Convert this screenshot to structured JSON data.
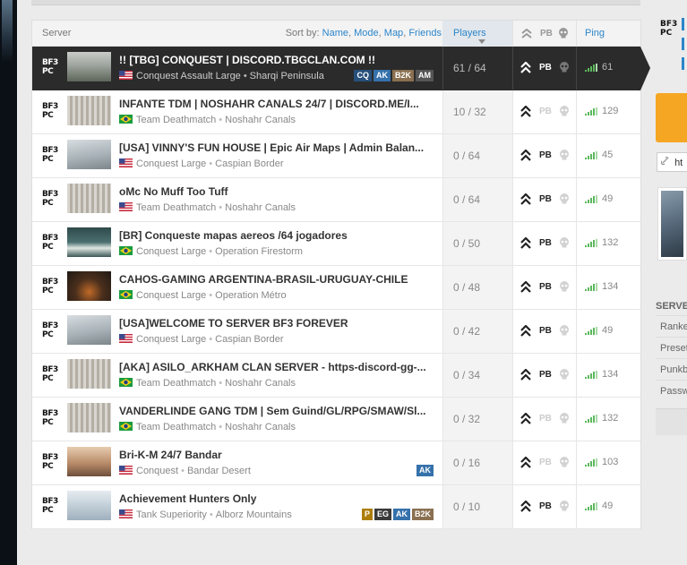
{
  "header": {
    "server_label": "Server",
    "sort_by_label": "Sort by:",
    "sort_options": [
      "Name",
      "Mode",
      "Map",
      "Friends"
    ],
    "players_label": "Players",
    "pb_label": "PB",
    "ping_label": "Ping"
  },
  "servers": [
    {
      "platform": "PC",
      "name": "!! [TBG] CONQUEST | DISCORD.TBGCLAN.COM !!",
      "mode": "Conquest Assault Large",
      "map": "Sharqi Peninsula",
      "flag": "us",
      "badges": [
        "CQ",
        "AK",
        "B2K",
        "AM"
      ],
      "players": "61 / 64",
      "pb": true,
      "ping": "61",
      "selected": true,
      "thumb": "a"
    },
    {
      "platform": "PC",
      "name": "INFANTE TDM | NOSHAHR CANALS 24/7 | DISCORD.ME/I...",
      "mode": "Team Deathmatch",
      "map": "Noshahr Canals",
      "flag": "br",
      "badges": [],
      "players": "10 / 32",
      "pb": false,
      "ping": "129",
      "selected": false,
      "thumb": "b"
    },
    {
      "platform": "PC",
      "name": "[USA] VINNY'S FUN HOUSE | Epic Air Maps | Admin Balan...",
      "mode": "Conquest Large",
      "map": "Caspian Border",
      "flag": "us",
      "badges": [],
      "players": "0 / 64",
      "pb": true,
      "ping": "45",
      "selected": false,
      "thumb": "c"
    },
    {
      "platform": "PC",
      "name": "oMc No Muff Too Tuff",
      "mode": "Team Deathmatch",
      "map": "Noshahr Canals",
      "flag": "us",
      "badges": [],
      "players": "0 / 64",
      "pb": true,
      "ping": "49",
      "selected": false,
      "thumb": "b"
    },
    {
      "platform": "PC",
      "name": "[BR] Conqueste mapas aereos /64 jogadores",
      "mode": "Conquest Large",
      "map": "Operation Firestorm",
      "flag": "br",
      "badges": [],
      "players": "0 / 50",
      "pb": true,
      "ping": "132",
      "selected": false,
      "thumb": "d"
    },
    {
      "platform": "PC",
      "name": "CAHOS-GAMING ARGENTINA-BRASIL-URUGUAY-CHILE",
      "mode": "Conquest Large",
      "map": "Operation Métro",
      "flag": "br",
      "badges": [],
      "players": "0 / 48",
      "pb": true,
      "ping": "134",
      "selected": false,
      "thumb": "e"
    },
    {
      "platform": "PC",
      "name": "[USA]WELCOME TO SERVER BF3 FOREVER",
      "mode": "Conquest Large",
      "map": "Caspian Border",
      "flag": "us",
      "badges": [],
      "players": "0 / 42",
      "pb": true,
      "ping": "49",
      "selected": false,
      "thumb": "c"
    },
    {
      "platform": "PC",
      "name": "[AKA] ASILO_ARKHAM CLAN SERVER - https-discord-gg-...",
      "mode": "Team Deathmatch",
      "map": "Noshahr Canals",
      "flag": "br",
      "badges": [],
      "players": "0 / 34",
      "pb": true,
      "ping": "134",
      "selected": false,
      "thumb": "b"
    },
    {
      "platform": "PC",
      "name": "VANDERLINDE GANG TDM | Sem Guind/GL/RPG/SMAW/Sl...",
      "mode": "Team Deathmatch",
      "map": "Noshahr Canals",
      "flag": "br",
      "badges": [],
      "players": "0 / 32",
      "pb": false,
      "ping": "132",
      "selected": false,
      "thumb": "b"
    },
    {
      "platform": "PC",
      "name": "Bri-K-M 24/7 Bandar",
      "mode": "Conquest",
      "map": "Bandar Desert",
      "flag": "us",
      "badges": [
        "AK"
      ],
      "players": "0 / 16",
      "pb": false,
      "ping": "103",
      "selected": false,
      "thumb": "f"
    },
    {
      "platform": "PC",
      "name": "Achievement Hunters Only",
      "mode": "Tank Superiority",
      "map": "Alborz Mountains",
      "flag": "us",
      "badges": [
        "P",
        "EG",
        "AK",
        "B2K"
      ],
      "players": "0 / 10",
      "pb": true,
      "ping": "49",
      "selected": false,
      "thumb": "g"
    }
  ],
  "sidebar": {
    "platform": "PC",
    "url_text": "ht",
    "section_title": "SERVE",
    "settings": [
      "Ranke",
      "Preset",
      "Punkb",
      "Passw"
    ]
  },
  "colors": {
    "accent_blue": "#2c85c9",
    "selected_row": "#2b2b2b",
    "join_orange": "#f5a623",
    "ping_green": "#5cb85c"
  }
}
